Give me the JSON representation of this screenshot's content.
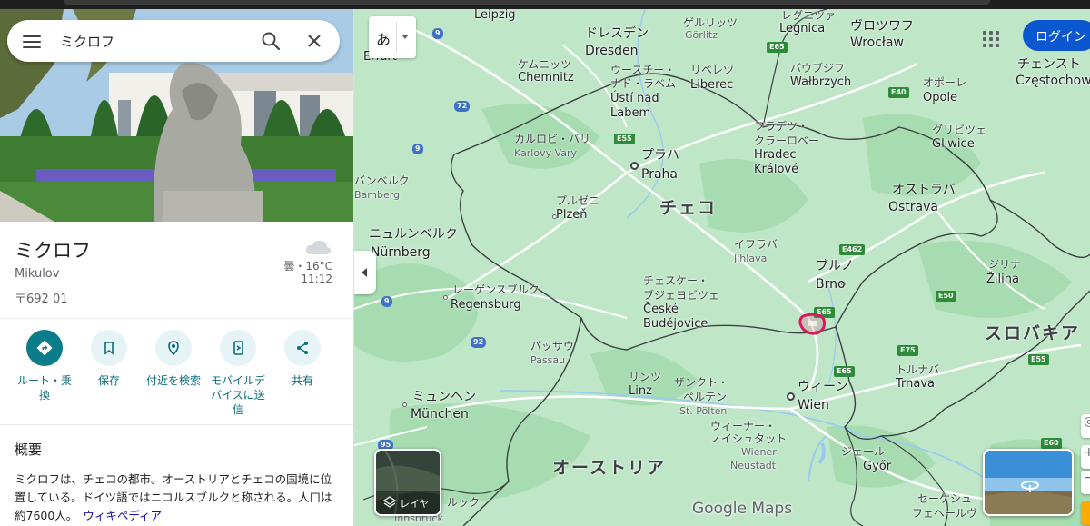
{
  "search": {
    "query": "ミクロフ"
  },
  "place": {
    "title": "ミクロフ",
    "subtitle": "Mikulov",
    "postal": "〒692 01",
    "weather": "曇・16°C",
    "time": "11:12"
  },
  "actions": [
    {
      "label": "ルート・乗換",
      "icon": "directions-icon"
    },
    {
      "label": "保存",
      "icon": "bookmark-icon"
    },
    {
      "label": "付近を検索",
      "icon": "nearby-icon"
    },
    {
      "label": "モバイルデバイスに送信",
      "icon": "send-to-phone-icon"
    },
    {
      "label": "共有",
      "icon": "share-icon"
    }
  ],
  "overview": {
    "title": "概要",
    "text": "ミクロフは、チェコの都市。オーストリアとチェコの国境に位置している。ドイツ語ではニコルスブルクと称される。人口は約7600人。",
    "link": "ウィキペディア"
  },
  "map": {
    "lang_button": "あ",
    "login": "ログイン",
    "layer_label": "レイヤ",
    "logo": "Google Maps",
    "colors": {
      "land": "#bfe7c7",
      "forest": "#a6dcb0",
      "border": "#3c4043",
      "road": "#ffffff",
      "marker": "#d81b60",
      "accent": "#0b57d0"
    },
    "labels": {
      "leipzig": "Leipzig",
      "gorlitz_ja": "ゲルリッツ",
      "gorlitz": "Görlitz",
      "legnica_ja": "レグニツァ",
      "legnica": "Legnica",
      "wroclaw_ja": "ヴロツワフ",
      "wroclaw": "Wrocław",
      "dresden_ja": "ドレスデン",
      "dresden": "Dresden",
      "erfurt": "Erfurt",
      "chemnitz_ja": "ケムニッツ",
      "chemnitz": "Chemnitz",
      "usti_ja": "ウースチー・",
      "usti_ja2": "ナド・ラベム",
      "usti": "Ústí nad",
      "usti2": "Labem",
      "liberec_ja": "リベレツ",
      "liberec": "Liberec",
      "walbrzych_ja": "バウブジフ",
      "walbrzych": "Wałbrzych",
      "opole_ja": "オポーレ",
      "opole": "Opole",
      "czesto_ja": "チェンスト",
      "czesto": "Częstochow",
      "karlovy_ja": "カルロビ・バリ",
      "karlovy": "Karlovy Vary",
      "praha_ja": "プラハ",
      "praha": "Praha",
      "hradec_ja": "フラデツ・",
      "hradec_ja2": "クラーロベー",
      "hradec": "Hradec",
      "hradec2": "Králové",
      "gliwice_ja": "グリビツェ",
      "gliwice": "Gliwice",
      "bamberg_ja": "バンベルク",
      "bamberg": "Bamberg",
      "plzen_ja": "プルゼニ",
      "plzen": "Plzeň",
      "czech": "チェコ",
      "ostrava_ja": "オストラバ",
      "ostrava": "Ostrava",
      "nurnberg_ja": "ニュルンベルク",
      "nurnberg": "Nürnberg",
      "jihlava_ja": "イフラバ",
      "jihlava": "Jihlava",
      "brno_ja": "ブルノ",
      "brno": "Brno",
      "zilina_ja": "ジリナ",
      "zilina": "Žilina",
      "regensburg_ja": "レーゲンスブルク",
      "regensburg": "Regensburg",
      "cb_ja": "チェスケー・",
      "cb_ja2": "ブジェヨビツェ",
      "cb": "České",
      "cb2": "Budějovice",
      "slovakia": "スロバキア",
      "passau_ja": "パッサウ",
      "passau": "Passau",
      "trnava_ja": "トルナバ",
      "trnava": "Trnava",
      "linz_ja": "リンツ",
      "linz": "Linz",
      "stpolten_ja": "ザンクト・",
      "stpolten_ja2": "ペルテン",
      "stpolten": "St. Pölten",
      "wien_ja": "ウィーン",
      "wien": "Wien",
      "munchen_ja": "ミュンヘン",
      "munchen": "München",
      "wn_ja": "ウィーナー・",
      "wn_ja2": "ノイシュタット",
      "wn": "Wiener",
      "wn2": "Neustadt",
      "austria": "オーストリア",
      "gyor_ja": "ジェール",
      "gyor": "Győr",
      "szek_ja": "セーケシュ",
      "szek_ja2": "フェヘールヴ",
      "innsbruck_ja": "ルック",
      "innsbruck": "Innsbruck"
    },
    "shields": {
      "e65a": "E65",
      "e40": "E40",
      "e55a": "E55",
      "e462": "E462",
      "e50": "E50",
      "e65b": "E65",
      "e75": "E75",
      "e65c": "E65",
      "e60": "E60",
      "e55b": "E55",
      "a9a": "9",
      "a72": "72",
      "a9b": "9",
      "a9c": "9",
      "a92": "92",
      "a95": "95"
    }
  }
}
